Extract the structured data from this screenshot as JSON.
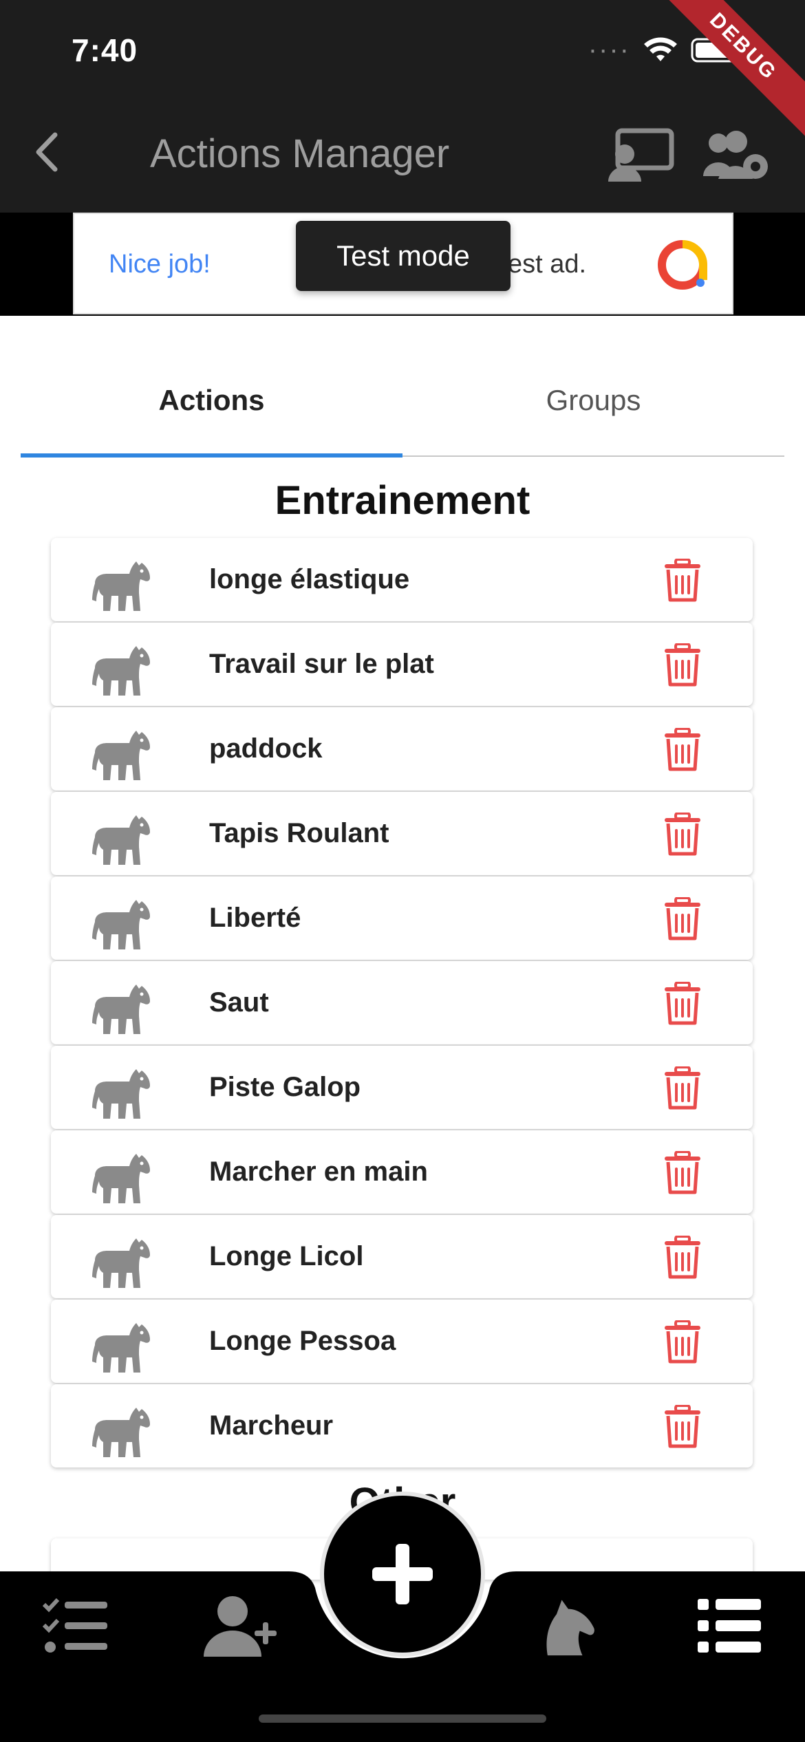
{
  "status_bar": {
    "time": "7:40",
    "debug_label": "DEBUG"
  },
  "app_bar": {
    "title": "Actions Manager"
  },
  "ad": {
    "left_text": "Nice job!",
    "right_text": "est ad.",
    "toast": "Test mode"
  },
  "tabs": [
    {
      "label": "Actions",
      "selected": true
    },
    {
      "label": "Groups",
      "selected": false
    }
  ],
  "sections": [
    {
      "title": "Entrainement",
      "items": [
        "longe élastique",
        "Travail sur le plat",
        "paddock",
        "Tapis Roulant",
        "Liberté",
        "Saut",
        "Piste Galop",
        "Marcher en main",
        "Longe Licol",
        "Longe Pessoa",
        "Marcheur"
      ]
    },
    {
      "title": "Other"
    }
  ],
  "colors": {
    "app_bar_bg": "#1d1d1d",
    "accent_tab": "#2f86e0",
    "trash_red": "#e84b4b",
    "horse_gray": "#8a8a8a",
    "nav_bg": "#000000"
  },
  "icons": {
    "back": "chevron-left-icon",
    "cast": "cast-user-icon",
    "settings": "users-gear-icon",
    "horse": "horse-icon",
    "delete": "trash-icon",
    "nav": [
      "checklist-icon",
      "add-user-icon",
      "add-icon",
      "horse-head-icon",
      "list-icon"
    ]
  }
}
